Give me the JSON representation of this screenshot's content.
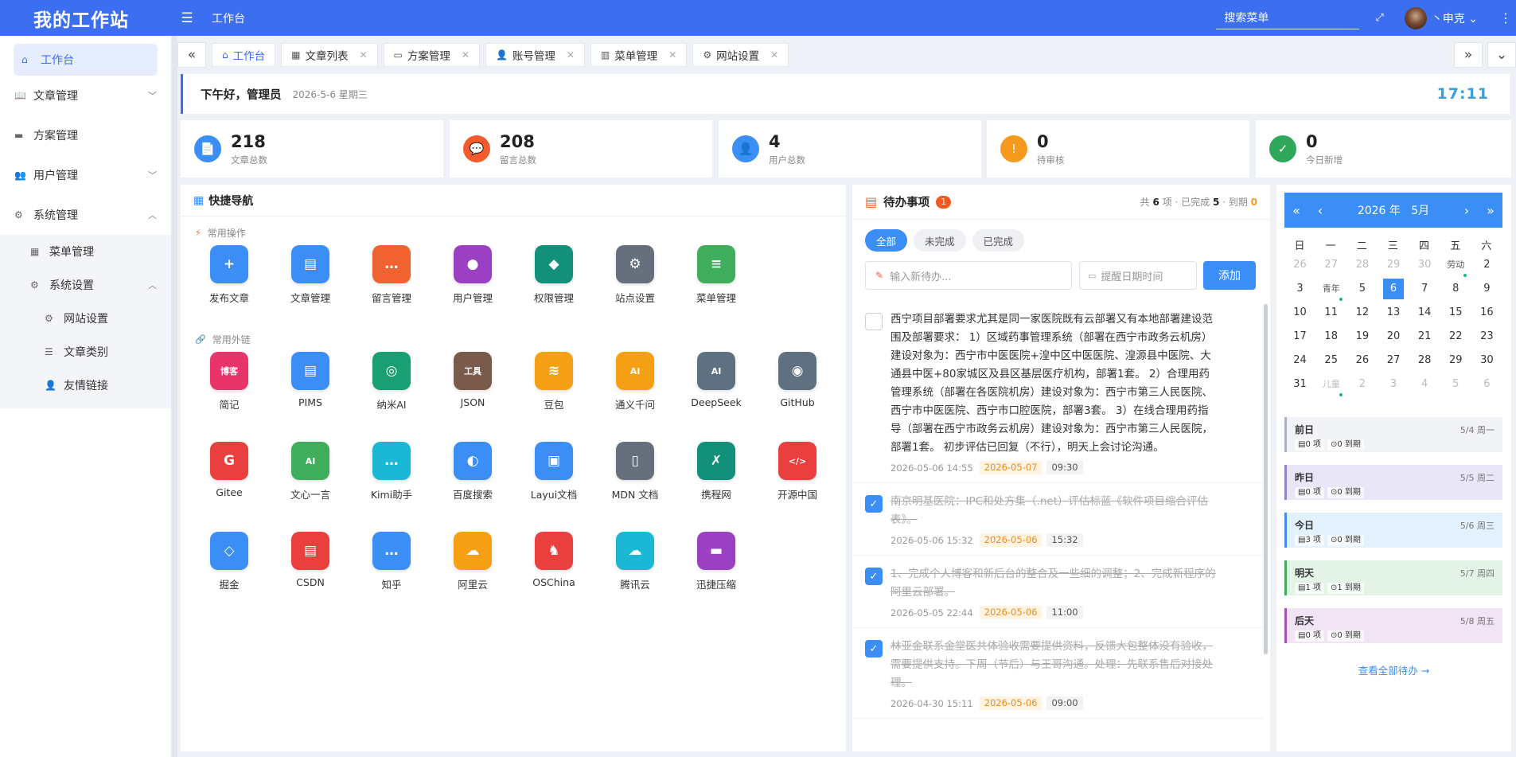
{
  "app": {
    "title": "我的工作站",
    "page": "工作台"
  },
  "topbar": {
    "search_label": "搜索菜单",
    "user": "丶申克",
    "colors": {
      "primary": "#3b6ef0"
    }
  },
  "sidebar": {
    "home": "工作台",
    "items": [
      {
        "label": "文章管理",
        "icon": "book-icon"
      },
      {
        "label": "方案管理",
        "icon": "monitor-icon"
      },
      {
        "label": "用户管理",
        "icon": "users-icon"
      },
      {
        "label": "系统管理",
        "icon": "gear-icon"
      }
    ],
    "sub": {
      "menu": "菜单管理",
      "settings": "系统设置"
    },
    "sub2": [
      {
        "label": "网站设置"
      },
      {
        "label": "文章类别"
      },
      {
        "label": "友情链接"
      }
    ]
  },
  "tabs": [
    {
      "label": "工作台",
      "icon": "⌂"
    },
    {
      "label": "文章列表",
      "icon": "▦"
    },
    {
      "label": "方案管理",
      "icon": "▭"
    },
    {
      "label": "账号管理",
      "icon": "👤"
    },
    {
      "label": "菜单管理",
      "icon": "▥"
    },
    {
      "label": "网站设置",
      "icon": "⚙"
    }
  ],
  "greeting": {
    "text": "下午好，管理员",
    "date": "2026-5-6 星期三",
    "clock": "17:11"
  },
  "stats": [
    {
      "value": "218",
      "label": "文章总数",
      "color": "#3b8ef5",
      "icon": "📄"
    },
    {
      "value": "208",
      "label": "留言总数",
      "color": "#f35a2c",
      "icon": "💬"
    },
    {
      "value": "4",
      "label": "用户总数",
      "color": "#3b8ef5",
      "icon": "👤"
    },
    {
      "value": "0",
      "label": "待审核",
      "color": "#f59a1f",
      "icon": "!"
    },
    {
      "value": "0",
      "label": "今日新增",
      "color": "#2fa85a",
      "icon": "✓"
    }
  ],
  "quicknav": {
    "title": "快捷导航",
    "sec1": "常用操作",
    "sec2": "常用外链",
    "ops": [
      {
        "label": "发布文章",
        "color": "#3b8ef5",
        "glyph": "+"
      },
      {
        "label": "文章管理",
        "color": "#3b8ef5",
        "glyph": "▤"
      },
      {
        "label": "留言管理",
        "color": "#f0622f",
        "glyph": "…"
      },
      {
        "label": "用户管理",
        "color": "#9b3fc3",
        "glyph": "●"
      },
      {
        "label": "权限管理",
        "color": "#12907a",
        "glyph": "◆"
      },
      {
        "label": "站点设置",
        "color": "#66707d",
        "glyph": "⚙"
      },
      {
        "label": "菜单管理",
        "color": "#3eae5c",
        "glyph": "≡"
      }
    ],
    "links": [
      {
        "label": "简记",
        "color": "#e8336b",
        "glyph": "博客"
      },
      {
        "label": "PIMS",
        "color": "#3b8ef5",
        "glyph": "▤"
      },
      {
        "label": "纳米AI",
        "color": "#1a9e74",
        "glyph": "◎"
      },
      {
        "label": "JSON",
        "color": "#7a5a4a",
        "glyph": "工具"
      },
      {
        "label": "豆包",
        "color": "#f5a015",
        "glyph": "≋"
      },
      {
        "label": "通义千问",
        "color": "#f5a015",
        "glyph": "AI"
      },
      {
        "label": "DeepSeek",
        "color": "#5f7180",
        "glyph": "AI"
      },
      {
        "label": "GitHub",
        "color": "#5f7180",
        "glyph": "◉"
      },
      {
        "label": "Gitee",
        "color": "#ea3f3f",
        "glyph": "G"
      },
      {
        "label": "文心一言",
        "color": "#3eae5c",
        "glyph": "AI"
      },
      {
        "label": "Kimi助手",
        "color": "#1bb8d6",
        "glyph": "…"
      },
      {
        "label": "百度搜索",
        "color": "#3b8ef5",
        "glyph": "◐"
      },
      {
        "label": "Layui文档",
        "color": "#3b8ef5",
        "glyph": "▣"
      },
      {
        "label": "MDN 文档",
        "color": "#66707d",
        "glyph": "▯"
      },
      {
        "label": "携程网",
        "color": "#12907a",
        "glyph": "✗"
      },
      {
        "label": "开源中国",
        "color": "#ea3f3f",
        "glyph": "</>"
      },
      {
        "label": "掘金",
        "color": "#3b8ef5",
        "glyph": "◇"
      },
      {
        "label": "CSDN",
        "color": "#ea3f3f",
        "glyph": "▤"
      },
      {
        "label": "知乎",
        "color": "#3b8ef5",
        "glyph": "…"
      },
      {
        "label": "阿里云",
        "color": "#f5a015",
        "glyph": "☁"
      },
      {
        "label": "OSChina",
        "color": "#ea3f3f",
        "glyph": "♞"
      },
      {
        "label": "腾讯云",
        "color": "#1bb8d6",
        "glyph": "☁"
      },
      {
        "label": "迅捷压缩",
        "color": "#9b3fc3",
        "glyph": "▬"
      }
    ]
  },
  "todo": {
    "title": "待办事项",
    "badge": "1",
    "summary": {
      "p1": "共",
      "total": "6",
      "p2": "项 · 已完成",
      "done": "5",
      "p3": "· 到期",
      "overdue": "0"
    },
    "filters": [
      "全部",
      "未完成",
      "已完成"
    ],
    "placeholder": "输入新待办...",
    "remind_placeholder": "提醒日期时间",
    "add": "添加",
    "items": [
      {
        "text": "西宁项目部署要求尤其是同一家医院既有云部署又有本地部署建设范围及部署要求： 1）区域药事管理系统（部署在西宁市政务云机房）建设对象为：西宁市中医医院+湟中区中医医院、湟源县中医院、大通县中医+80家城区及县区基层医疗机构，部署1套。 2）合理用药管理系统（部署在各医院机房）建设对象为：西宁市第三人民医院、西宁市中医医院、西宁市口腔医院，部署3套。 3）在线合理用药指导（部署在西宁市政务云机房）建设对象为：西宁市第三人民医院，部署1套。 初步评估已回复（不行），明天上会讨论沟通。",
        "created": "2026-05-06 14:55",
        "due": "2026-05-07",
        "time": "09:30",
        "done": false
      },
      {
        "text": "南京明基医院：IPC和处方集（.net）评估标蓝《软件项目缩合评估表》。",
        "created": "2026-05-06 15:32",
        "due": "2026-05-06",
        "time": "15:32",
        "done": true
      },
      {
        "text": "1、完成个人博客和新后台的整合及一些细的调整；2、完成新程序的阿里云部署。",
        "created": "2026-05-05 22:44",
        "due": "2026-05-06",
        "time": "11:00",
        "done": true
      },
      {
        "text": "林亚金联系金堂医共体验收需要提供资料，反馈大包整体没有验收，需要提供支持。下周（节后）与王哥沟通。处理：先联系售后对接处理。",
        "created": "2026-04-30 15:11",
        "due": "2026-05-06",
        "time": "09:00",
        "done": true
      }
    ]
  },
  "calendar": {
    "year": "2026 年",
    "month": "5月",
    "weekdays": [
      "日",
      "一",
      "二",
      "三",
      "四",
      "五",
      "六"
    ],
    "days": [
      {
        "t": "26",
        "dim": true
      },
      {
        "t": "27",
        "dim": true
      },
      {
        "t": "28",
        "dim": true
      },
      {
        "t": "29",
        "dim": true
      },
      {
        "t": "30",
        "dim": true
      },
      {
        "t": "劳动",
        "hol": true,
        "dot": true
      },
      {
        "t": "2"
      },
      {
        "t": "3"
      },
      {
        "t": "青年",
        "hol": true,
        "dot": true
      },
      {
        "t": "5"
      },
      {
        "t": "6",
        "today": true
      },
      {
        "t": "7"
      },
      {
        "t": "8"
      },
      {
        "t": "9"
      },
      {
        "t": "10"
      },
      {
        "t": "11"
      },
      {
        "t": "12"
      },
      {
        "t": "13"
      },
      {
        "t": "14"
      },
      {
        "t": "15"
      },
      {
        "t": "16"
      },
      {
        "t": "17"
      },
      {
        "t": "18"
      },
      {
        "t": "19"
      },
      {
        "t": "20"
      },
      {
        "t": "21"
      },
      {
        "t": "22"
      },
      {
        "t": "23"
      },
      {
        "t": "24"
      },
      {
        "t": "25"
      },
      {
        "t": "26"
      },
      {
        "t": "27"
      },
      {
        "t": "28"
      },
      {
        "t": "29"
      },
      {
        "t": "30"
      },
      {
        "t": "31"
      },
      {
        "t": "儿童",
        "hol": true,
        "dim": true,
        "dot": true
      },
      {
        "t": "2",
        "dim": true
      },
      {
        "t": "3",
        "dim": true
      },
      {
        "t": "4",
        "dim": true
      },
      {
        "t": "5",
        "dim": true
      },
      {
        "t": "6",
        "dim": true
      }
    ],
    "day_cards": [
      {
        "name": "前日",
        "date": "5/4 周一",
        "items": "▤0 项",
        "due": "⊙0 到期",
        "bg": "#f1f3f6",
        "bar": "#aab2c0"
      },
      {
        "name": "昨日",
        "date": "5/5 周二",
        "items": "▤0 项",
        "due": "⊙0 到期",
        "bg": "#e8e6f7",
        "bar": "#8e84d6"
      },
      {
        "name": "今日",
        "date": "5/6 周三",
        "items": "▤3 项",
        "due": "⊙0 到期",
        "bg": "#e3f0fd",
        "bar": "#3b8ef5"
      },
      {
        "name": "明天",
        "date": "5/7 周四",
        "items": "▤1 项",
        "due": "⊙1 到期",
        "bg": "#e3f4e6",
        "bar": "#3eae5c"
      },
      {
        "name": "后天",
        "date": "5/8 周五",
        "items": "▤0 项",
        "due": "⊙0 到期",
        "bg": "#f0e4f5",
        "bar": "#a552c8"
      }
    ],
    "view_all": "查看全部待办 →"
  }
}
